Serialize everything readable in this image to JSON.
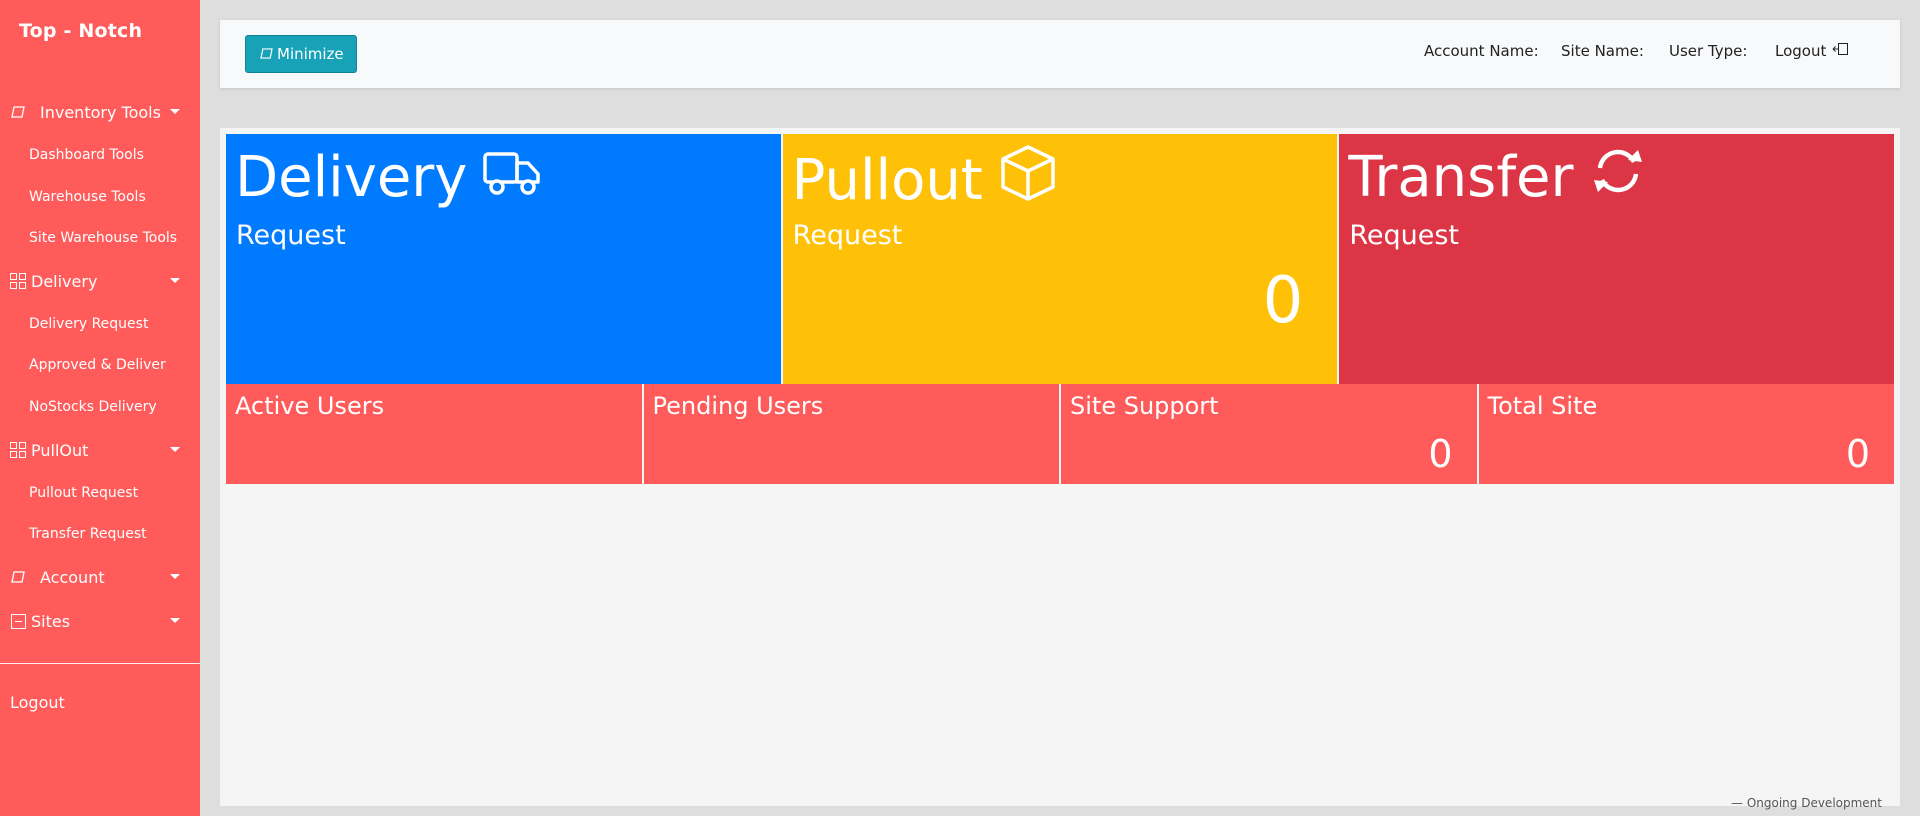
{
  "sidebar": {
    "brand": "Top - Notch",
    "groups": [
      {
        "label": "Inventory Tools",
        "icon": "tablet-icon"
      },
      {
        "label": "Delivery",
        "icon": "grid-icon"
      },
      {
        "label": "PullOut",
        "icon": "grid-icon"
      },
      {
        "label": "Account",
        "icon": "tablet-icon"
      },
      {
        "label": "Sites",
        "icon": "window-icon"
      }
    ],
    "items": [
      "Dashboard Tools",
      "Warehouse Tools",
      "Site Warehouse Tools",
      "Delivery Request",
      "Approved & Deliver",
      "NoStocks Delivery",
      "Pullout Request",
      "Transfer Request"
    ],
    "logout": "Logout"
  },
  "topbar": {
    "minimize_label": "Minimize",
    "account_name_label": "Account Name:",
    "site_name_label": "Site Name:",
    "user_type_label": "User Type:",
    "logout_label": "Logout"
  },
  "cards": [
    {
      "title": "Delivery",
      "subtitle": "Request",
      "value": "",
      "icon": "truck-icon",
      "color": "#007bff"
    },
    {
      "title": "Pullout",
      "subtitle": "Request",
      "value": "0",
      "icon": "box-icon",
      "color": "#ffc107"
    },
    {
      "title": "Transfer",
      "subtitle": "Request",
      "value": "",
      "icon": "sync-icon",
      "color": "#dc3545"
    }
  ],
  "stats": [
    {
      "label": "Active Users",
      "value": ""
    },
    {
      "label": "Pending Users",
      "value": ""
    },
    {
      "label": "Site Support",
      "value": "0"
    },
    {
      "label": "Total Site",
      "value": "0"
    }
  ],
  "footer_note": "— Ongoing Development"
}
